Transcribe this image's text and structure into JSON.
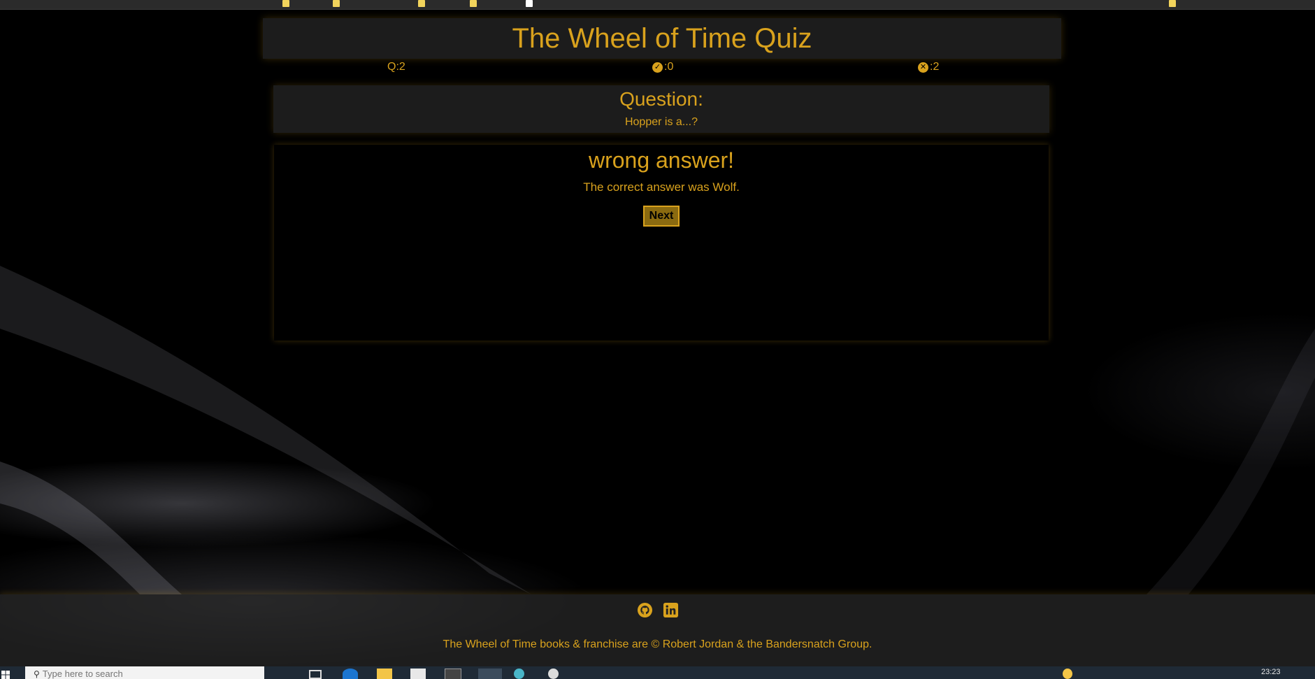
{
  "app": {
    "title": "The Wheel of Time Quiz"
  },
  "stats": {
    "question_label": "Q:2",
    "correct_count": ":0",
    "wrong_count": ":2"
  },
  "question": {
    "heading": "Question:",
    "text": "Hopper is a...?"
  },
  "result": {
    "heading": "wrong answer!",
    "message": "The correct answer was Wolf.",
    "next_label": "Next"
  },
  "footer": {
    "icons": [
      "github-icon",
      "linkedin-icon"
    ],
    "copyright": "The Wheel of Time books & franchise are © Robert Jordan & the Bandersnatch Group."
  },
  "taskbar": {
    "search_placeholder": "Type here to search",
    "clock": "23:23"
  },
  "colors": {
    "accent": "#d9a21d",
    "panel": "#1c1c1c",
    "background": "#000000",
    "button_fill": "#8a6a10"
  }
}
